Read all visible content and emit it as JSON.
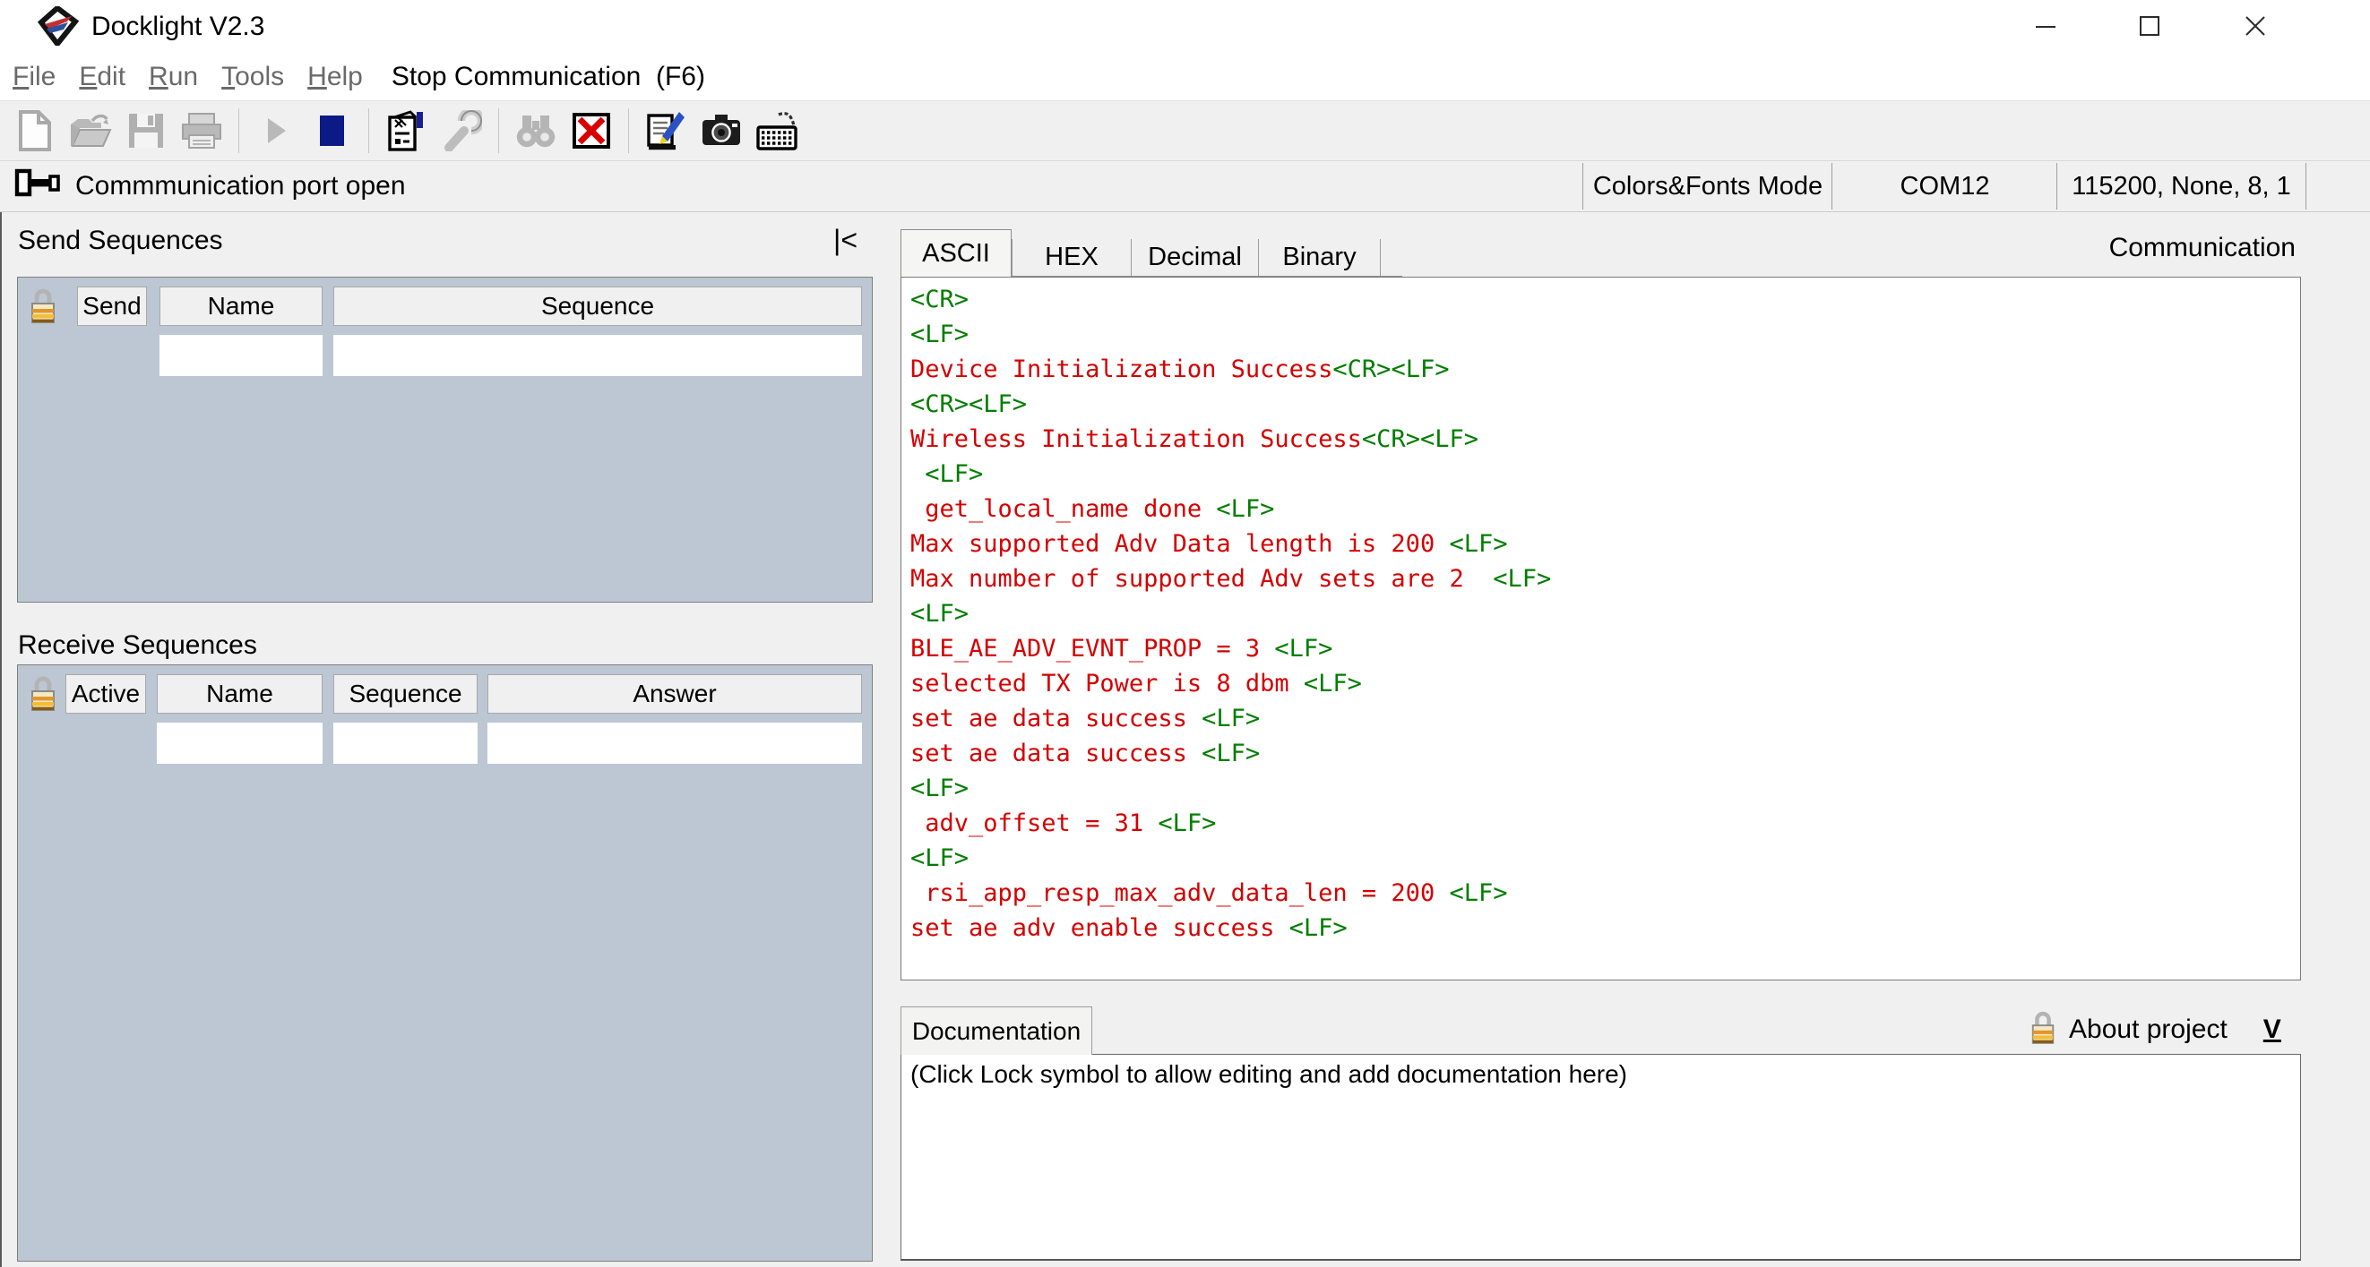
{
  "window": {
    "title": "Docklight V2.3"
  },
  "menu": {
    "items": [
      "File",
      "Edit",
      "Run",
      "Tools",
      "Help"
    ],
    "action_label": "Stop Communication  (F6)"
  },
  "toolbar": {
    "icons": [
      "new-file",
      "open-project",
      "save-project",
      "print",
      "start-communication",
      "stop-communication",
      "project-settings",
      "options-wrench",
      "find-binoculars",
      "clear-communication-window",
      "notepad-edit",
      "snapshot-camera",
      "keyboard-console"
    ]
  },
  "statusbar": {
    "message": "Commmunication port open",
    "mode": "Colors&Fonts Mode",
    "port": "COM12",
    "port_settings": "115200, None, 8, 1"
  },
  "send_sequences": {
    "title": "Send Sequences",
    "collapse_label": "|<",
    "columns": [
      "Send",
      "Name",
      "Sequence"
    ]
  },
  "receive_sequences": {
    "title": "Receive Sequences",
    "columns": [
      "Active",
      "Name",
      "Sequence",
      "Answer"
    ]
  },
  "terminal": {
    "tabs": [
      "ASCII",
      "HEX",
      "Decimal",
      "Binary"
    ],
    "active_tab": "ASCII",
    "pane_label": "Communication",
    "lines": [
      [
        [
          "<CR>",
          "g"
        ]
      ],
      [
        [
          "<LF>",
          "g"
        ]
      ],
      [
        [
          "Device Initialization Success",
          "r"
        ],
        [
          "<CR>",
          "g"
        ],
        [
          "<LF>",
          "g"
        ]
      ],
      [
        [
          "<CR>",
          "g"
        ],
        [
          "<LF>",
          "g"
        ]
      ],
      [
        [
          "Wireless Initialization Success",
          "r"
        ],
        [
          "<CR>",
          "g"
        ],
        [
          "<LF>",
          "g"
        ]
      ],
      [
        [
          " ",
          "r"
        ],
        [
          "<LF>",
          "g"
        ]
      ],
      [
        [
          " get_local_name done ",
          "r"
        ],
        [
          "<LF>",
          "g"
        ]
      ],
      [
        [
          "Max supported Adv Data length is 200 ",
          "r"
        ],
        [
          "<LF>",
          "g"
        ]
      ],
      [
        [
          "Max number of supported Adv sets are 2  ",
          "r"
        ],
        [
          "<LF>",
          "g"
        ]
      ],
      [
        [
          "<LF>",
          "g"
        ]
      ],
      [
        [
          "BLE_AE_ADV_EVNT_PROP = 3 ",
          "r"
        ],
        [
          "<LF>",
          "g"
        ]
      ],
      [
        [
          "selected TX Power is 8 dbm ",
          "r"
        ],
        [
          "<LF>",
          "g"
        ]
      ],
      [
        [
          "set ae data success ",
          "r"
        ],
        [
          "<LF>",
          "g"
        ]
      ],
      [
        [
          "set ae data success ",
          "r"
        ],
        [
          "<LF>",
          "g"
        ]
      ],
      [
        [
          "<LF>",
          "g"
        ]
      ],
      [
        [
          " adv_offset = 31 ",
          "r"
        ],
        [
          "<LF>",
          "g"
        ]
      ],
      [
        [
          "<LF>",
          "g"
        ]
      ],
      [
        [
          " rsi_app_resp_max_adv_data_len = 200 ",
          "r"
        ],
        [
          "<LF>",
          "g"
        ]
      ],
      [
        [
          "set ae adv enable success ",
          "r"
        ],
        [
          "<LF>",
          "g"
        ]
      ]
    ]
  },
  "documentation": {
    "tab_label": "Documentation",
    "about_label": "About project",
    "expand_label": "V",
    "text": "(Click Lock symbol to allow editing and add documentation here)"
  },
  "colors": {
    "data_red": "#d40000",
    "tag_green": "#007d00",
    "panel_blue": "#bcc7d3",
    "stop_navy": "#0c1a86"
  }
}
